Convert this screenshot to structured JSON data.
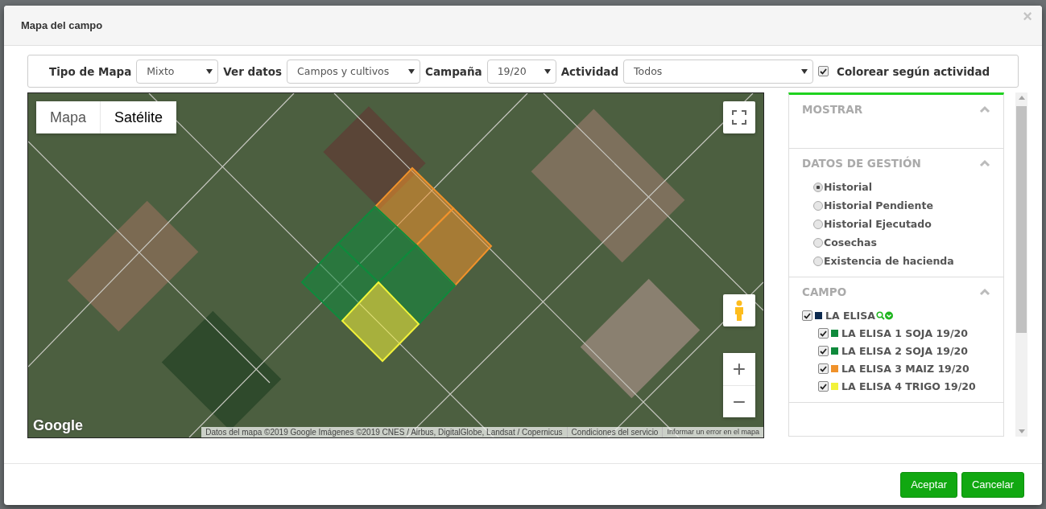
{
  "dialog": {
    "title": "Mapa del campo",
    "close": "×"
  },
  "toolbar": {
    "fields": [
      {
        "label": "Tipo de Mapa",
        "value": "Mixto"
      },
      {
        "label": "Ver datos",
        "value": "Campos y cultivos"
      },
      {
        "label": "Campaña",
        "value": "19/20"
      },
      {
        "label": "Actividad",
        "value": "Todos"
      }
    ],
    "color_by_activity": {
      "label": "Colorear según actividad",
      "checked": true
    }
  },
  "map": {
    "types": [
      {
        "label": "Mapa",
        "selected": false
      },
      {
        "label": "Satélite",
        "selected": true
      }
    ],
    "zoom_in": "+",
    "zoom_out": "−",
    "logo": "Google",
    "attribution": [
      "Datos del mapa ©2019 Google Imágenes ©2019 CNES / Airbus, DigitalGlobe, Landsat / Copernicus",
      "Condiciones del servicio",
      "Informar un error en el mapa"
    ]
  },
  "side_panel": {
    "sections": [
      {
        "kind": "empty",
        "title": "MOSTRAR",
        "expanded": true
      },
      {
        "kind": "radios",
        "title": "DATOS DE GESTIÓN",
        "expanded": true,
        "options": [
          {
            "label": "Historial",
            "selected": true
          },
          {
            "label": "Historial Pendiente",
            "selected": false
          },
          {
            "label": "Historial Ejecutado",
            "selected": false
          },
          {
            "label": "Cosechas",
            "selected": false
          },
          {
            "label": "Existencia de hacienda",
            "selected": false
          }
        ]
      },
      {
        "kind": "tree",
        "title": "CAMPO",
        "expanded": true,
        "items": [
          {
            "label": "LA ELISA",
            "checked": true,
            "color": "#0d2a4f",
            "children": [
              {
                "label": "LA ELISA 1 SOJA 19/20",
                "checked": true,
                "color": "#0f8a3c"
              },
              {
                "label": "LA ELISA 2 SOJA 19/20",
                "checked": true,
                "color": "#0f8a3c"
              },
              {
                "label": "LA ELISA 3 MAIZ 19/20",
                "checked": true,
                "color": "#f0922b"
              },
              {
                "label": "LA ELISA 4 TRIGO 19/20",
                "checked": true,
                "color": "#f2f23a"
              }
            ]
          }
        ]
      }
    ]
  },
  "footer": {
    "buttons": [
      "Aceptar",
      "Cancelar"
    ]
  }
}
